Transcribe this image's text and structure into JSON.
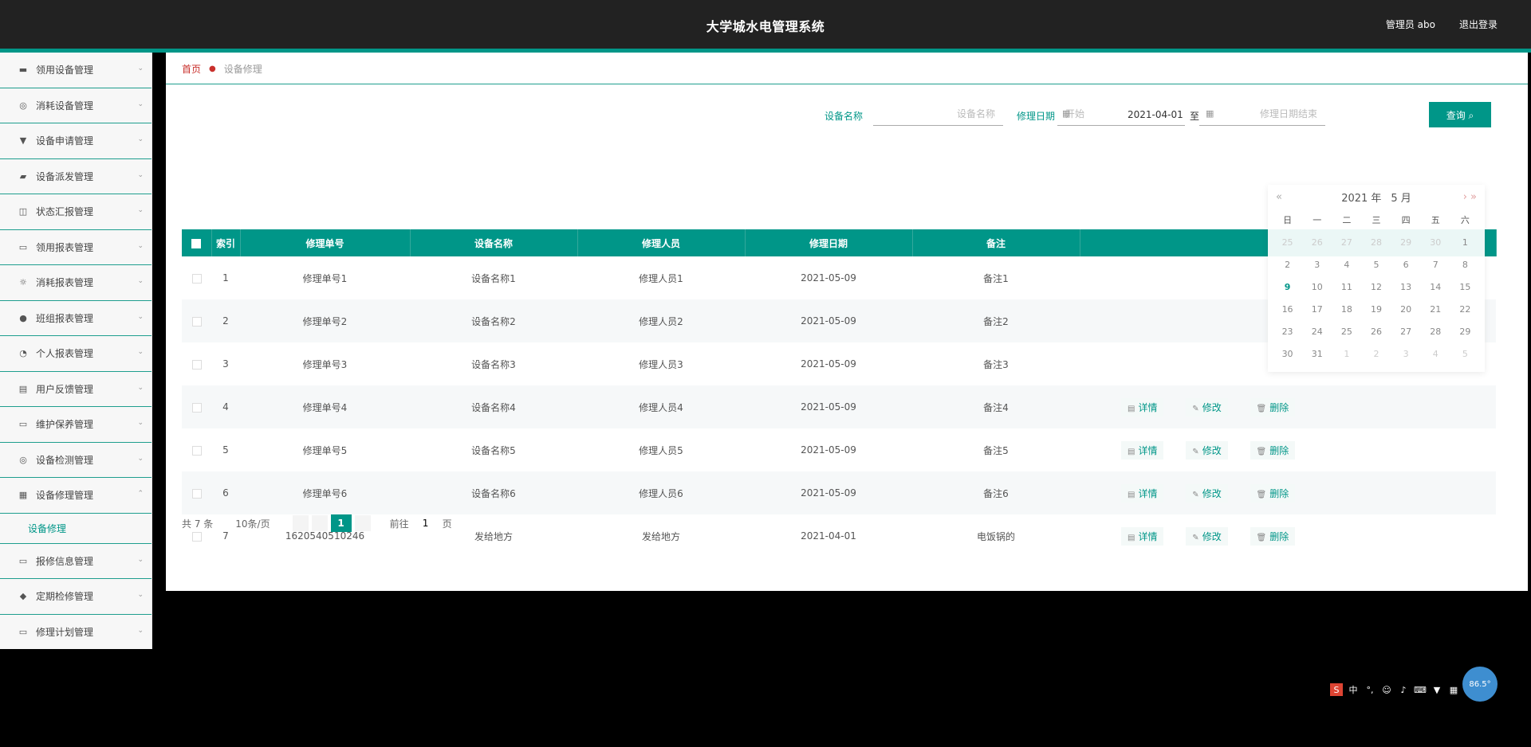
{
  "header": {
    "title": "大学城水电管理系统",
    "user": "管理员 abo",
    "logout": "退出登录"
  },
  "sidebar": {
    "items": [
      {
        "label": "领用设备管理",
        "icon": "▬"
      },
      {
        "label": "消耗设备管理",
        "icon": "◎"
      },
      {
        "label": "设备申请管理",
        "icon": "▼"
      },
      {
        "label": "设备派发管理",
        "icon": "▰"
      },
      {
        "label": "状态汇报管理",
        "icon": "◫"
      },
      {
        "label": "领用报表管理",
        "icon": "▭"
      },
      {
        "label": "消耗报表管理",
        "icon": "☼"
      },
      {
        "label": "班组报表管理",
        "icon": "●"
      },
      {
        "label": "个人报表管理",
        "icon": "◔"
      },
      {
        "label": "用户反馈管理",
        "icon": "▤"
      },
      {
        "label": "维护保养管理",
        "icon": "▭"
      },
      {
        "label": "设备检测管理",
        "icon": "◎"
      },
      {
        "label": "设备修理管理",
        "icon": "▦"
      },
      {
        "label": "报修信息管理",
        "icon": "▭"
      },
      {
        "label": "定期检修管理",
        "icon": "◆"
      },
      {
        "label": "修理计划管理",
        "icon": "▭"
      }
    ],
    "submenu": "设备修理"
  },
  "breadcrumb": {
    "home": "首页",
    "current": "设备修理"
  },
  "search": {
    "device_label": "设备名称",
    "device_placeholder": "设备名称",
    "date_label": "修理日期",
    "date_start_placeholder": "开始",
    "date_start_value": "2021-04-01",
    "to_label": "至",
    "date_end_placeholder": "修理日期结束",
    "query_label": "查询"
  },
  "table": {
    "headers": [
      "索引",
      "修理单号",
      "设备名称",
      "修理人员",
      "修理日期",
      "备注"
    ],
    "rows": [
      {
        "index": "1",
        "no": "修理单号1",
        "device": "设备名称1",
        "person": "修理人员1",
        "date": "2021-05-09",
        "note": "备注1"
      },
      {
        "index": "2",
        "no": "修理单号2",
        "device": "设备名称2",
        "person": "修理人员2",
        "date": "2021-05-09",
        "note": "备注2"
      },
      {
        "index": "3",
        "no": "修理单号3",
        "device": "设备名称3",
        "person": "修理人员3",
        "date": "2021-05-09",
        "note": "备注3"
      },
      {
        "index": "4",
        "no": "修理单号4",
        "device": "设备名称4",
        "person": "修理人员4",
        "date": "2021-05-09",
        "note": "备注4"
      },
      {
        "index": "5",
        "no": "修理单号5",
        "device": "设备名称5",
        "person": "修理人员5",
        "date": "2021-05-09",
        "note": "备注5"
      },
      {
        "index": "6",
        "no": "修理单号6",
        "device": "设备名称6",
        "person": "修理人员6",
        "date": "2021-05-09",
        "note": "备注6"
      },
      {
        "index": "7",
        "no": "1620540510246",
        "device": "发给地方",
        "person": "发给地方",
        "date": "2021-04-01",
        "note": "电饭锅的"
      }
    ],
    "actions": {
      "detail": "详情",
      "edit": "修改",
      "delete": "删除"
    }
  },
  "pagination": {
    "total": "共 7 条",
    "page_size": "10条/页",
    "current_page": "1",
    "goto_label": "前往",
    "goto_value": "1",
    "page_suffix": "页"
  },
  "datepicker": {
    "year": "2021 年",
    "month": "5 月",
    "prev": "«",
    "next": "› »",
    "weekdays": [
      "日",
      "一",
      "二",
      "三",
      "四",
      "五",
      "六"
    ],
    "days": [
      {
        "d": "25",
        "o": true
      },
      {
        "d": "26",
        "o": true
      },
      {
        "d": "27",
        "o": true
      },
      {
        "d": "28",
        "o": true
      },
      {
        "d": "29",
        "o": true
      },
      {
        "d": "30",
        "o": true
      },
      {
        "d": "1",
        "o": false
      },
      {
        "d": "2",
        "o": false
      },
      {
        "d": "3",
        "o": false
      },
      {
        "d": "4",
        "o": false
      },
      {
        "d": "5",
        "o": false
      },
      {
        "d": "6",
        "o": false
      },
      {
        "d": "7",
        "o": false
      },
      {
        "d": "8",
        "o": false
      },
      {
        "d": "9",
        "o": false,
        "t": true
      },
      {
        "d": "10",
        "o": false
      },
      {
        "d": "11",
        "o": false
      },
      {
        "d": "12",
        "o": false
      },
      {
        "d": "13",
        "o": false
      },
      {
        "d": "14",
        "o": false
      },
      {
        "d": "15",
        "o": false
      },
      {
        "d": "16",
        "o": false
      },
      {
        "d": "17",
        "o": false
      },
      {
        "d": "18",
        "o": false
      },
      {
        "d": "19",
        "o": false
      },
      {
        "d": "20",
        "o": false
      },
      {
        "d": "21",
        "o": false
      },
      {
        "d": "22",
        "o": false
      },
      {
        "d": "23",
        "o": false
      },
      {
        "d": "24",
        "o": false
      },
      {
        "d": "25",
        "o": false
      },
      {
        "d": "26",
        "o": false
      },
      {
        "d": "27",
        "o": false
      },
      {
        "d": "28",
        "o": false
      },
      {
        "d": "29",
        "o": false
      },
      {
        "d": "30",
        "o": false
      },
      {
        "d": "31",
        "o": false
      },
      {
        "d": "1",
        "o": true
      },
      {
        "d": "2",
        "o": true
      },
      {
        "d": "3",
        "o": true
      },
      {
        "d": "4",
        "o": true
      },
      {
        "d": "5",
        "o": true
      }
    ]
  },
  "float_button": "86.5°",
  "colors": {
    "primary": "#009688",
    "header": "#222222",
    "danger": "#c9302c"
  }
}
